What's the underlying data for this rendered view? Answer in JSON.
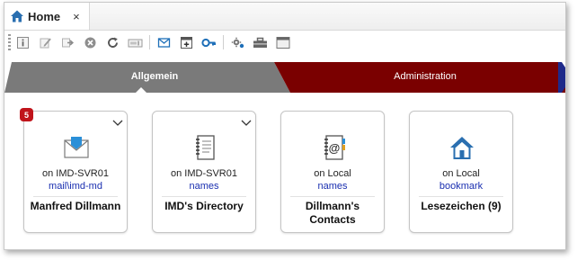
{
  "window": {
    "tab": {
      "label": "Home",
      "icon": "home-icon",
      "close": "×"
    }
  },
  "toolbar": {
    "buttons": [
      "info-icon",
      "edit-icon",
      "forward-icon",
      "delete-icon",
      "refresh-icon",
      "rename-icon",
      "email-icon",
      "add-icon",
      "key-icon",
      "settings-icon",
      "toolbox-icon",
      "window-icon"
    ]
  },
  "ribbon": {
    "tabs": [
      {
        "label": "Allgemein",
        "color": "#7a7a7a",
        "active": true
      },
      {
        "label": "Administration",
        "color": "#7a0000",
        "active": false
      }
    ]
  },
  "cards": [
    {
      "title": "Manfred Dillmann",
      "server": "on IMD-SVR01",
      "db": "mail\\imd-md",
      "icon": "mail-icon",
      "badge": "5",
      "has_menu": true
    },
    {
      "title": "IMD's Directory",
      "server": "on IMD-SVR01",
      "db": "names",
      "icon": "directory-book-icon",
      "badge": "",
      "has_menu": true
    },
    {
      "title": "Dillmann's Contacts",
      "server": "on Local",
      "db": "names",
      "icon": "contacts-book-icon",
      "badge": "",
      "has_menu": false
    },
    {
      "title": "Lesezeichen (9)",
      "server": "on Local",
      "db": "bookmark",
      "icon": "home-icon",
      "badge": "",
      "has_menu": false
    }
  ],
  "colors": {
    "accent_blue": "#1a2fb0",
    "badge_red": "#c0141b",
    "home_blue": "#2a6fb0"
  }
}
